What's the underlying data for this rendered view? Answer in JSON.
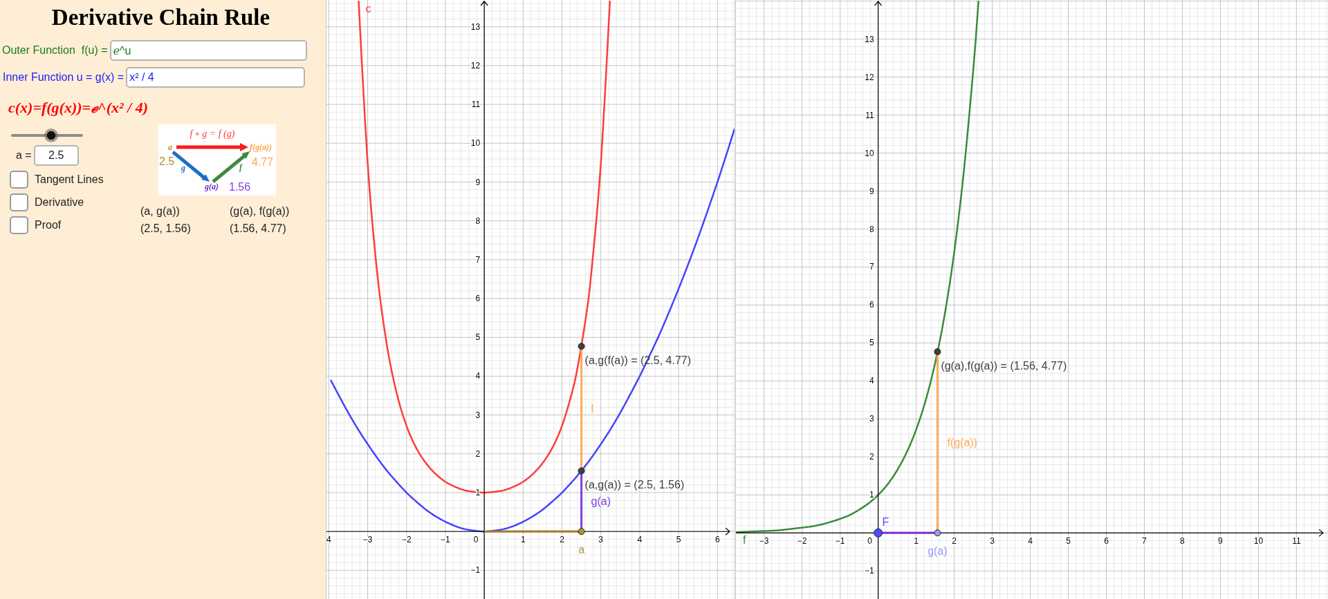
{
  "title": "Derivative Chain Rule",
  "outer_function": {
    "label": "Outer Function  f(u) =",
    "value": "ℯ^u"
  },
  "inner_function": {
    "label": "Inner Function u = g(x) =",
    "value": "x² / 4"
  },
  "composite_formula": "c(x)=f(g(x))=ℯ^(x² / 4)",
  "slider": {
    "level": 0.56,
    "label": "a =",
    "value": "2.5"
  },
  "checkboxes": [
    {
      "label": "Tangent Lines",
      "checked": false
    },
    {
      "label": "Derivative",
      "checked": false
    },
    {
      "label": "Proof",
      "checked": false
    }
  ],
  "composition_diagram": {
    "caption": "f ∘ g = f (g)",
    "input_label": "a",
    "input_value": "2.5",
    "inner_arrow_label": "g",
    "middle_label": "g(a)",
    "middle_value": "1.56",
    "outer_arrow_label": "f",
    "output_label": "f(g(a))",
    "output_value": "4.77"
  },
  "coordinates_table": {
    "headers": [
      "(a, g(a))",
      "(g(a), f(g(a))"
    ],
    "values": [
      "(2.5, 1.56)",
      "(1.56, 4.77)"
    ]
  },
  "graphs": [
    {
      "chart_data": {
        "type": "line",
        "grid": true,
        "x": [
          -3.95,
          -3.75,
          -3.5,
          -3.234,
          -3,
          -2.75,
          -2.5,
          -2.25,
          -2,
          -1.75,
          -1.5,
          -1.25,
          -1,
          -0.75,
          -0.5,
          -0.25,
          0,
          0.25,
          0.5,
          0.75,
          1,
          1.25,
          1.5,
          1.75,
          2,
          2.25,
          2.4,
          2.6,
          2.75,
          3,
          3.234,
          3.5,
          3.75,
          4,
          4.25,
          4.5,
          4.75,
          5,
          5.25,
          5.5,
          5.75,
          6,
          6.25,
          6.44
        ],
        "series": [
          {
            "name": "c",
            "color": "#ff3c3c",
            "values": [
              null,
              null,
              null,
              13.67,
              9.49,
              6.62,
              4.77,
              3.55,
              2.72,
              2.15,
              1.76,
              1.48,
              1.28,
              1.15,
              1.06,
              1.02,
              1,
              1.02,
              1.06,
              1.15,
              1.28,
              1.48,
              1.76,
              2.15,
              2.72,
              3.55,
              4.22,
              5.42,
              6.62,
              9.49,
              13.67,
              null,
              null,
              null,
              null,
              null,
              null,
              null,
              null,
              null,
              null,
              null,
              null,
              null
            ]
          },
          {
            "color": "#4444ff",
            "values": [
              3.9,
              3.52,
              3.06,
              2.61,
              2.25,
              1.89,
              1.56,
              1.27,
              1,
              0.77,
              0.56,
              0.39,
              0.25,
              0.14,
              0.06,
              0.02,
              0,
              0.02,
              0.06,
              0.14,
              0.25,
              0.39,
              0.56,
              0.77,
              1,
              1.27,
              1.44,
              1.69,
              1.89,
              2.25,
              2.61,
              3.06,
              3.52,
              4,
              4.52,
              5.06,
              5.64,
              6.25,
              6.89,
              7.56,
              8.27,
              9,
              9.77,
              10.37
            ]
          }
        ],
        "xlim": [
          -4.06,
          6.44
        ],
        "ylim": [
          -1.74,
          13.69
        ],
        "xticks": [
          {
            "value": -4,
            "label": "4"
          },
          {
            "value": -3,
            "label": "−3"
          },
          {
            "value": -2,
            "label": "−2"
          },
          {
            "value": -1,
            "label": "−1"
          },
          1,
          2,
          3,
          4,
          5,
          6
        ],
        "yticks": [
          {
            "value": -1,
            "label": "−1"
          },
          1,
          2,
          3,
          4,
          5,
          6,
          7,
          8,
          9,
          10,
          11,
          12,
          13
        ]
      },
      "origin_label": "0",
      "constructions": [
        {
          "kind": "top-point",
          "color": "#404040",
          "label": "(a,g(f(a)) = (2.5, 4.77)"
        },
        {
          "kind": "upper-segment",
          "color": "#ffaa55",
          "label": "l"
        },
        {
          "kind": "middle-point",
          "color": "#404040",
          "label": "(a,g(a)) = (2.5, 1.56)"
        },
        {
          "kind": "lower-segment",
          "color": "#7b3fe0",
          "label": "g(a)"
        },
        {
          "kind": "axis-segment",
          "color": "#a0782d"
        },
        {
          "kind": "axis-point",
          "color": "#b8903c",
          "label": "a"
        }
      ]
    },
    {
      "chart_data": {
        "type": "line",
        "grid": true,
        "x": [
          -3.74,
          -3.5,
          -3.25,
          -3,
          -2.75,
          -2.5,
          -2.25,
          -2,
          -1.75,
          -1.5,
          -1.25,
          -1,
          -0.75,
          -0.5,
          -0.25,
          0,
          0.25,
          0.5,
          0.75,
          1,
          1.25,
          1.5,
          1.75,
          2,
          2.25,
          2.5,
          2.64
        ],
        "series": [
          {
            "name": "f",
            "color": "#3a8a3a",
            "values": [
              0.02,
              0.03,
              0.04,
              0.05,
              0.06,
              0.08,
              0.11,
              0.14,
              0.17,
              0.22,
              0.29,
              0.37,
              0.47,
              0.61,
              0.78,
              1,
              1.28,
              1.65,
              2.12,
              2.72,
              3.49,
              4.48,
              5.75,
              7.39,
              9.49,
              12.18,
              14.01
            ]
          }
        ],
        "xlim": [
          -3.74,
          11.83
        ],
        "ylim": [
          -1.74,
          14.03
        ],
        "xticks": [
          {
            "value": -3,
            "label": "−3"
          },
          {
            "value": -2,
            "label": "−2"
          },
          {
            "value": -1,
            "label": "−1"
          },
          1,
          2,
          3,
          4,
          5,
          6,
          7,
          8,
          9,
          10,
          11
        ],
        "yticks": [
          {
            "value": -1,
            "label": "−1"
          },
          1,
          2,
          3,
          4,
          5,
          6,
          7,
          8,
          9,
          10,
          11,
          12,
          13
        ]
      },
      "origin_label": "0",
      "constructions": [
        {
          "kind": "top-point",
          "color": "#404040",
          "label": "(g(a),f(g(a)) = (1.56, 4.77)"
        },
        {
          "kind": "full-segment",
          "color": "#ffaa55",
          "label": "f(g(a))"
        },
        {
          "kind": "origin-point",
          "color": "#4d4dff",
          "label": "F"
        },
        {
          "kind": "axis-segment",
          "color": "#7a2fd0"
        },
        {
          "kind": "axis-point",
          "color": "#9999ff",
          "label": "g(a)"
        }
      ]
    }
  ]
}
